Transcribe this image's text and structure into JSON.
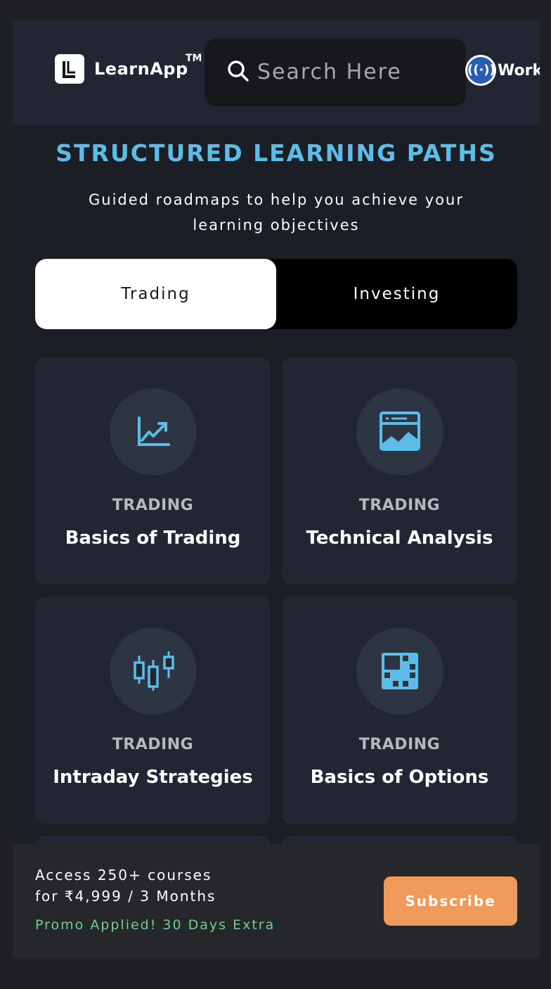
{
  "header": {
    "brand": "LearnApp",
    "trademark": "TM",
    "search_placeholder": "Search Here",
    "workshop_label": "Work"
  },
  "hero": {
    "title": "STRUCTURED LEARNING PATHS",
    "subtitle": "Guided roadmaps to help you achieve your learning objectives"
  },
  "tabs": [
    {
      "label": "Trading",
      "active": true
    },
    {
      "label": "Investing",
      "active": false
    }
  ],
  "cards": [
    {
      "category": "TRADING",
      "name": "Basics of Trading",
      "icon": "line-chart-icon"
    },
    {
      "category": "TRADING",
      "name": "Technical Analysis",
      "icon": "chart-window-icon"
    },
    {
      "category": "TRADING",
      "name": "Intraday Strategies",
      "icon": "candlestick-icon"
    },
    {
      "category": "TRADING",
      "name": "Basics of Options",
      "icon": "grid-matrix-icon"
    }
  ],
  "offer": {
    "line1": "Access 250+ courses",
    "line2": "for ₹4,999 / 3 Months",
    "promo": "Promo Applied! 30 Days Extra",
    "cta": "Subscribe"
  },
  "colors": {
    "accent": "#5bbde8",
    "cta": "#ef9a5b",
    "promo": "#6dd38c",
    "card": "#222633"
  }
}
